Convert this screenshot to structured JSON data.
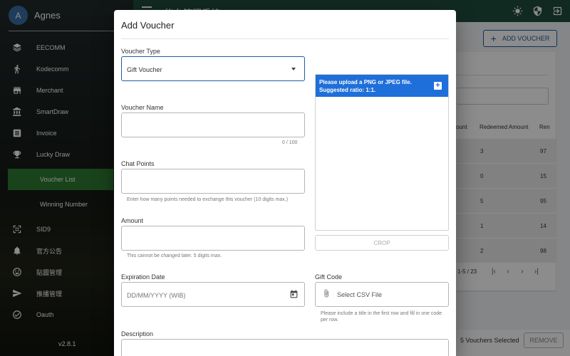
{
  "sidebar": {
    "user": {
      "initial": "A",
      "name": "Agnes"
    },
    "items": [
      {
        "label": "EECOMM",
        "icon": "layers-icon"
      },
      {
        "label": "Kodecomm",
        "icon": "person-walking-icon"
      },
      {
        "label": "Merchant",
        "icon": "store-icon"
      },
      {
        "label": "SmartDraw",
        "icon": "bank-icon"
      },
      {
        "label": "Invoice",
        "icon": "receipt-icon"
      },
      {
        "label": "Lucky Draw",
        "icon": "trophy-icon"
      },
      {
        "label": "SID9",
        "icon": "qr-scan-icon"
      },
      {
        "label": "官方公告",
        "icon": "bell-icon"
      },
      {
        "label": "貼圖管理",
        "icon": "smiley-icon"
      },
      {
        "label": "推播管理",
        "icon": "send-icon"
      },
      {
        "label": "Oauth",
        "icon": "check-circle-icon"
      }
    ],
    "subitems": [
      {
        "label": "Voucher List",
        "active": true
      },
      {
        "label": "Winning Number",
        "active": false
      }
    ],
    "version": "v2.8.1"
  },
  "topbar": {
    "title": "後台管理系統",
    "icons": [
      "brightness-icon",
      "shield-icon",
      "logout-icon"
    ]
  },
  "main": {
    "add_voucher_label": "ADD VOUCHER",
    "table": {
      "headers": [
        "ount",
        "Redeemed Amount",
        "Ren"
      ],
      "rows": [
        {
          "redeemed": "3",
          "rem": "97"
        },
        {
          "redeemed": "0",
          "rem": "15"
        },
        {
          "redeemed": "5",
          "rem": "95"
        },
        {
          "redeemed": "1",
          "rem": "14"
        },
        {
          "redeemed": "2",
          "rem": "98"
        }
      ]
    },
    "pagination": {
      "range": "1-5 / 23"
    },
    "selection": {
      "text": "5 Vouchers Selected",
      "remove_label": "REMOVE"
    }
  },
  "dialog": {
    "title": "Add Voucher",
    "voucher_type": {
      "label": "Voucher Type",
      "value": "Gift Voucher"
    },
    "voucher_name": {
      "label": "Voucher Name",
      "counter": "0 / 100"
    },
    "chat_points": {
      "label": "Chat Points",
      "helper": "Enter how many points needed to exchange this voucher (10 digits max.)"
    },
    "amount": {
      "label": "Amount",
      "helper": "This cannot be changed later. 5 digits max."
    },
    "expiration_date": {
      "label": "Expiration Date",
      "placeholder": "DD/MM/YYYY (WIB)"
    },
    "description": {
      "label": "Description"
    },
    "upload": {
      "line1": "Please upload a PNG or JPEG file.",
      "line2": "Suggested ratio: 1:1."
    },
    "crop_label": "CROP",
    "gift_code": {
      "label": "Gift Code",
      "placeholder": "Select CSV File",
      "helper": "Please include a title in the first row and fill in one code per row."
    }
  }
}
